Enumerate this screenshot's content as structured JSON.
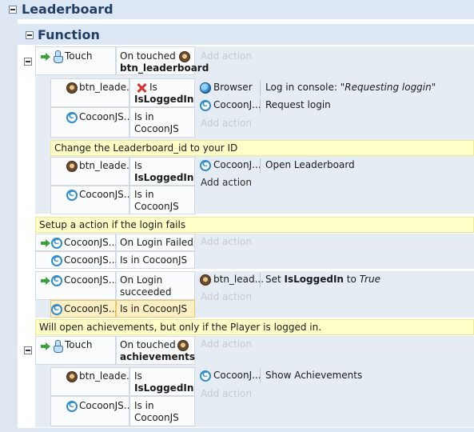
{
  "group_leaderboard": {
    "title": "Leaderboard"
  },
  "group_function": {
    "title": "Function"
  },
  "add_action": "Add action",
  "events": [
    {
      "condition": {
        "object": "Touch",
        "text1": "On touched",
        "text2": "btn_leaderboard"
      },
      "subevents": [
        {
          "conditions": [
            {
              "object": "btn_leade...",
              "text1": "Is",
              "text2": "IsLoggedIn",
              "inverted": true
            },
            {
              "object": "CocoonJS...",
              "text1": "Is in",
              "text2": "CocoonJS"
            }
          ],
          "actions": [
            {
              "object": "Browser",
              "text": "Log in console: ",
              "italic": "\"Requesting loggin\""
            },
            {
              "object": "CocoonJ...",
              "text": "Request login"
            }
          ]
        }
      ],
      "comment": "Change the Leaderboard_id to your ID",
      "subevent2": {
        "conditions": [
          {
            "object": "btn_leade...",
            "text1": "Is",
            "text2": "IsLoggedIn"
          },
          {
            "object": "CocoonJS...",
            "text1": "Is in",
            "text2": "CocoonJS"
          }
        ],
        "actions": [
          {
            "object": "CocoonJ...",
            "text": "Open Leaderboard"
          }
        ]
      }
    }
  ],
  "comment2": "Setup a action if the login fails",
  "event_failed": {
    "conditions": [
      {
        "object": "CocoonJS...",
        "text1": "On Login Failed"
      },
      {
        "object": "CocoonJS...",
        "text1": "Is in CocoonJS"
      }
    ]
  },
  "event_success": {
    "conditions": [
      {
        "object": "CocoonJS...",
        "text1": "On Login",
        "text2": "succeeded"
      },
      {
        "object": "CocoonJS...",
        "text1": "Is in CocoonJS"
      }
    ],
    "action": {
      "object": "btn_lead...",
      "text_pre": "Set ",
      "bold": "IsLoggedIn",
      "text_mid": " to ",
      "italic": "True"
    }
  },
  "comment3": "Will open achievements, but only if the Player is logged in.",
  "event_ach": {
    "condition": {
      "object": "Touch",
      "text1": "On touched",
      "text2": "achievements"
    },
    "sub": {
      "conditions": [
        {
          "object": "btn_leade...",
          "text1": "Is",
          "text2": "IsLoggedIn"
        },
        {
          "object": "CocoonJS...",
          "text1": "Is in",
          "text2": "CocoonJS"
        }
      ],
      "actions": [
        {
          "object": "CocoonJ...",
          "text": "Show Achievements"
        }
      ]
    }
  }
}
